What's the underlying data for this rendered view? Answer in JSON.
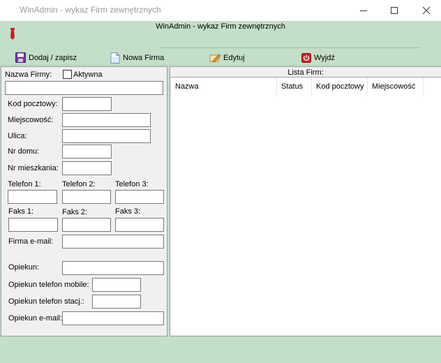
{
  "window": {
    "title": "WinAdmin - wykaz Firm zewnętrznych",
    "controls": {
      "minimize": "minimize",
      "maximize": "maximize",
      "close": "close"
    }
  },
  "header": {
    "title": "WinAdmin - wykaz Firm zewnętrznych"
  },
  "toolbar": {
    "save_label": "Dodaj / zapisz",
    "new_label": "Nowa Firma",
    "edit_label": "Edytuj",
    "exit_label": "Wyjdź"
  },
  "form": {
    "company_name_label": "Nazwa Firmy:",
    "active_label": "Aktywna",
    "active_checked": false,
    "postal_code_label": "Kod pocztowy:",
    "city_label": "Miejscowość:",
    "street_label": "Ulica:",
    "house_no_label": "Nr domu:",
    "apartment_no_label": "Nr mieszkania:",
    "phone1_label": "Telefon 1:",
    "phone2_label": "Telefon 2:",
    "phone3_label": "Telefon 3:",
    "fax1_label": "Faks 1:",
    "fax2_label": "Faks 2:",
    "fax3_label": "Faks 3:",
    "company_email_label": "Firma e-mail:",
    "caretaker_label": "Opiekun:",
    "caretaker_mobile_label": "Opiekun telefon mobile:",
    "caretaker_landline_label": "Opiekun telefon stacj.:",
    "caretaker_email_label": "Opiekun e-mail:"
  },
  "list": {
    "title": "Lista Firm:",
    "columns": [
      "Nazwa",
      "Status",
      "Kod pocztowy",
      "Miejscowość"
    ],
    "rows": []
  },
  "colors": {
    "background": "#c4dfc8",
    "panel": "#f0f0f0",
    "title_text": "#9a9a9a"
  }
}
